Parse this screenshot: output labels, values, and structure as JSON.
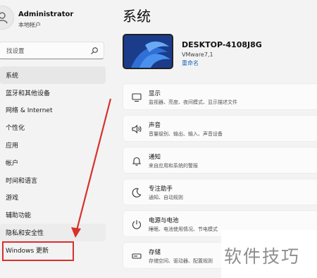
{
  "user": {
    "name": "Administrator",
    "account_type": "本地帐户"
  },
  "search": {
    "placeholder": "找设置"
  },
  "nav": {
    "items": [
      {
        "label": "系统"
      },
      {
        "label": "蓝牙和其他设备"
      },
      {
        "label": "网络 & Internet"
      },
      {
        "label": "个性化"
      },
      {
        "label": "应用"
      },
      {
        "label": "帐户"
      },
      {
        "label": "时间和语言"
      },
      {
        "label": "游戏"
      },
      {
        "label": "辅助功能"
      },
      {
        "label": "隐私和安全性"
      },
      {
        "label": "Windows 更新"
      }
    ]
  },
  "main": {
    "title": "系统",
    "device": {
      "name": "DESKTOP-4108J8G",
      "model": "VMware7,1",
      "rename": "重命名"
    },
    "settings": [
      {
        "title": "显示",
        "subtitle": "监视器、亮度、夜间模式、显示描述文件",
        "icon": "monitor-icon"
      },
      {
        "title": "声音",
        "subtitle": "音量级别、输出、输入、声音设备",
        "icon": "speaker-icon"
      },
      {
        "title": "通知",
        "subtitle": "来自应用和系统的警报",
        "icon": "bell-icon"
      },
      {
        "title": "专注助手",
        "subtitle": "通知、自动规则",
        "icon": "moon-icon"
      },
      {
        "title": "电源与电池",
        "subtitle": "睡眠、电池使用情况、节电模式",
        "icon": "power-icon"
      },
      {
        "title": "存储",
        "subtitle": "存储空间、驱动器、配置规则",
        "icon": "storage-icon"
      }
    ]
  },
  "watermark": {
    "text": "软件技巧"
  },
  "colors": {
    "accent": "#1a66b8",
    "annotation": "#d9302c",
    "wallpaper": "#1c3f8c"
  }
}
